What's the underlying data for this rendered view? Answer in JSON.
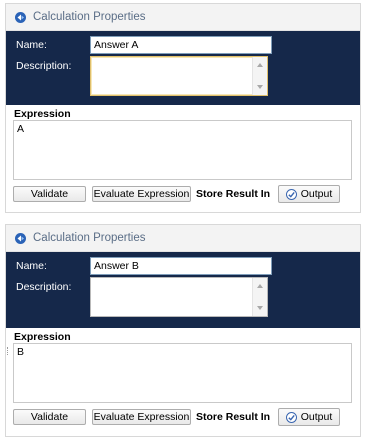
{
  "panels": [
    {
      "title": "Calculation Properties",
      "name_label": "Name:",
      "name_value": "Answer A",
      "description_label": "Description:",
      "description_value": "",
      "expression_label": "Expression",
      "expression_value": "A",
      "validate_label": "Validate",
      "evaluate_label": "Evaluate Expression",
      "store_result_label": "Store Result In",
      "output_label": "Output"
    },
    {
      "title": "Calculation Properties",
      "name_label": "Name:",
      "name_value": "Answer B",
      "description_label": "Description:",
      "description_value": "",
      "expression_label": "Expression",
      "expression_value": "B",
      "validate_label": "Validate",
      "evaluate_label": "Evaluate Expression",
      "store_result_label": "Store Result In",
      "output_label": "Output"
    }
  ],
  "colors": {
    "header_navy": "#15284a",
    "title_text": "#5a6d86",
    "focus_border": "#e0c06c"
  },
  "icons": {
    "title": "calculation-properties-icon",
    "output": "checkmark-icon"
  }
}
